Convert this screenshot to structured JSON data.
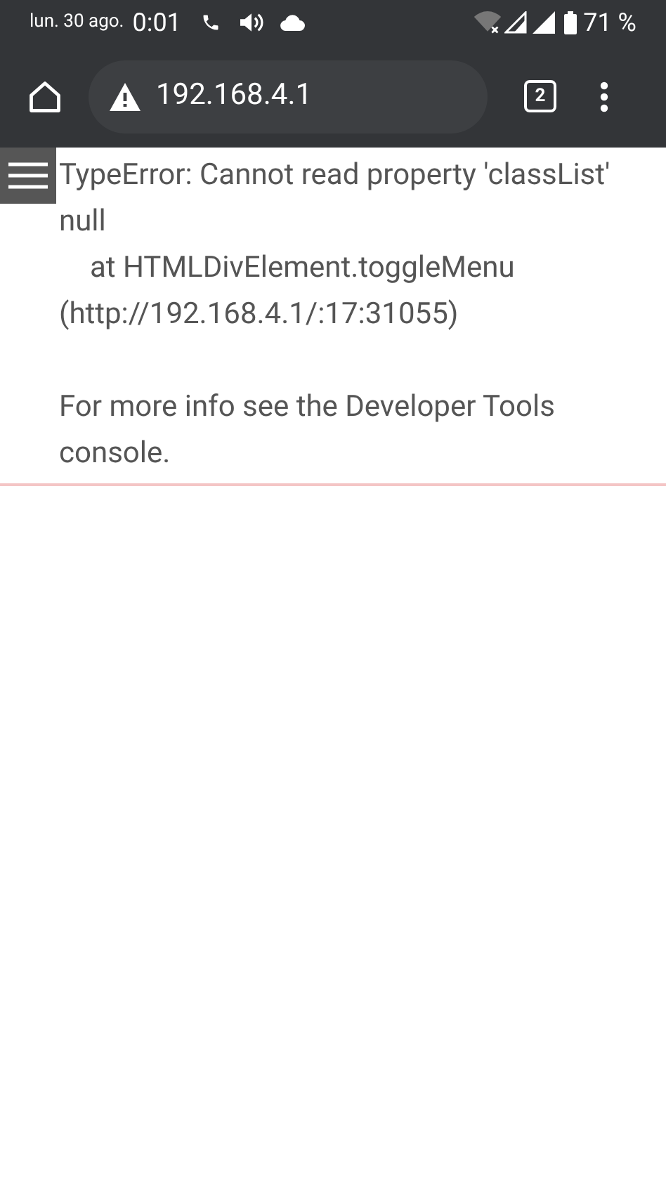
{
  "status_bar": {
    "date": "lun. 30 ago.",
    "time": "0:01",
    "battery": "71 %"
  },
  "browser_toolbar": {
    "url": "192.168.4.1",
    "tab_count": "2"
  },
  "error": {
    "lines": [
      {
        "text": "TypeError: Cannot read property 'classList'",
        "indented": false
      },
      {
        "text": "null",
        "indented": false
      },
      {
        "text": "at HTMLDivElement.toggleMenu",
        "indented": true
      },
      {
        "text": "(http://192.168.4.1/:17:31055)",
        "indented": false
      }
    ],
    "note": "For more info see the Developer Tools console."
  }
}
